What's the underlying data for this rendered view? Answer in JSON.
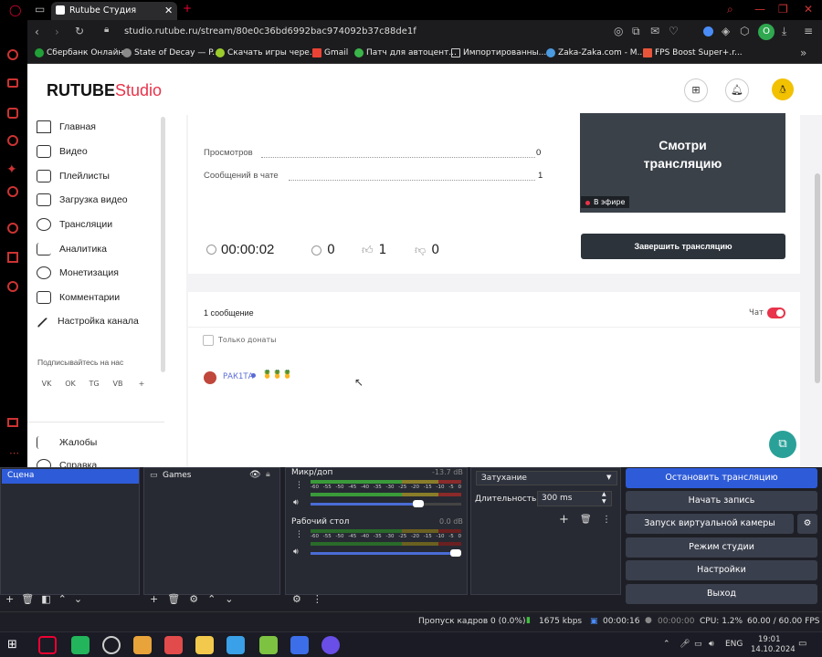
{
  "browser": {
    "tab_title": "Rutube Студия",
    "url": "studio.rutube.ru/stream/80e0c36bd6992bac974092b37c88de1f",
    "bookmarks": [
      "Сбербанк Онлайн",
      "State of Decay — P...",
      "Скачать игры чере...",
      "Gmail",
      "Патч для автоцент...",
      "Импортированны...",
      "Zaka-Zaka.com - М...",
      "FPS Boost Super+.r..."
    ],
    "profile": "О"
  },
  "studio": {
    "logo_main": "RUTUBE",
    "logo_accent": "Studio",
    "nav": [
      "Главная",
      "Видео",
      "Плейлисты",
      "Загрузка видео",
      "Трансляции",
      "Аналитика",
      "Монетизация",
      "Комментарии",
      "Настройка канала"
    ],
    "subscribe_label": "Подписывайтесь на нас",
    "socials": [
      "VK",
      "OK",
      "TG",
      "VB",
      "+"
    ],
    "nav_bottom": [
      "Жалобы",
      "Справка"
    ],
    "stats": [
      {
        "label": "Просмотров",
        "value": "0"
      },
      {
        "label": "Сообщений в чате",
        "value": "1"
      }
    ],
    "preview_text": "Смотри трансляцию",
    "live_badge": "В эфире",
    "timer": "00:00:02",
    "viewers": "0",
    "likes": "1",
    "dislikes": "0",
    "end_button": "Завершить трансляцию",
    "messages_count": "1 сообщение",
    "chat_label": "Чат",
    "donations_only": "Только донаты",
    "chat_user": "РАК1ТА",
    "chat_text": "🍍🍍🍍"
  },
  "obs": {
    "scene": "Сцена",
    "source": "Games",
    "mixer": [
      {
        "name": "Микр/доп",
        "db": "-13.7 dB",
        "level": 0.75
      },
      {
        "name": "Рабочий стол",
        "db": "0.0 dB",
        "level": 1.0
      }
    ],
    "meter_ticks": [
      "-60",
      "-55",
      "-50",
      "-45",
      "-40",
      "-35",
      "-30",
      "-25",
      "-20",
      "-15",
      "-10",
      "-5",
      "0"
    ],
    "transition": "Затухание",
    "duration_label": "Длительность",
    "duration": "300 ms",
    "controls": [
      "Остановить трансляцию",
      "Начать запись",
      "Запуск виртуальной камеры",
      "Режим студии",
      "Настройки",
      "Выход"
    ],
    "status": {
      "dropped": "Пропуск кадров 0 (0.0%)",
      "bitrate": "1675 kbps",
      "stream_time": "00:00:16",
      "rec_time": "00:00:00",
      "cpu": "CPU: 1.2%",
      "fps": "60.00 / 60.00 FPS"
    }
  },
  "taskbar": {
    "lang": "ENG",
    "time": "19:01",
    "date": "14.10.2024"
  },
  "colors": {
    "accent": "#e8334a",
    "obs_active": "#2e5bd8",
    "bg": "#f3f3f5"
  }
}
